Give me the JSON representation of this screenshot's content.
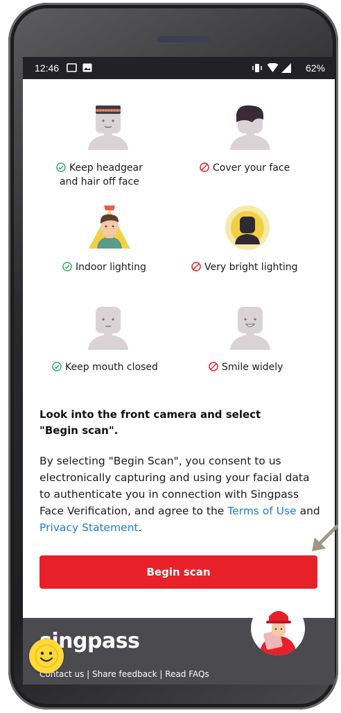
{
  "status_bar": {
    "time": "12:46",
    "battery": "62%"
  },
  "tips": [
    {
      "label": "Keep headgear",
      "label2": "and hair off face",
      "ok": true
    },
    {
      "label": "Cover your face",
      "ok": false
    },
    {
      "label": "Indoor lighting",
      "ok": true
    },
    {
      "label": "Very bright lighting",
      "ok": false
    },
    {
      "label": "Keep mouth closed",
      "ok": true
    },
    {
      "label": "Smile widely",
      "ok": false
    }
  ],
  "instructions": {
    "headline_line1": "Look into the front camera and select",
    "headline_line2": "\"Begin scan\".",
    "consent_text": "By selecting \"Begin Scan\", you consent to us electronically capturing and using your facial data to authenticate you in connection with Singpass Face Verification, and agree to the ",
    "terms_link": "Terms of Use",
    "and_text": " and ",
    "privacy_link": "Privacy Statement",
    "end_text": "."
  },
  "begin_button": {
    "label": "Begin scan"
  },
  "footer": {
    "brand": "singpass",
    "links": "Contact us | Share feedback | Read FAQs"
  },
  "colors": {
    "ok": "#2eae5f",
    "bad": "#e8202a",
    "button": "#e8202a",
    "link": "#1e7ad6"
  }
}
